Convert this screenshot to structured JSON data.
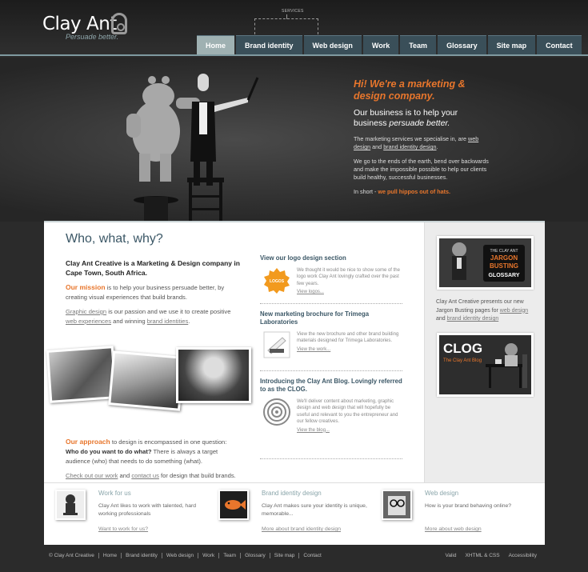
{
  "brand": {
    "name": "Clay Ant",
    "tagline": "Persuade better."
  },
  "header": {
    "services_note": "SERVICES"
  },
  "nav": [
    "Home",
    "Brand identity",
    "Web design",
    "Work",
    "Team",
    "Glossary",
    "Site map",
    "Contact"
  ],
  "hero": {
    "headline": "Hi! We're a marketing & design company.",
    "lead_a": "Our business is to help your business ",
    "lead_b": "persuade better.",
    "p1_a": "The marketing services we specialise in, are ",
    "p1_link1": "web design",
    "p1_b": " and ",
    "p1_link2": "brand identity design",
    "p1_c": ".",
    "p2": "We go to the ends of the earth, bend over backwards and make the impossible possible to help our clients build healthy, successful businesses.",
    "p3_a": "In short - ",
    "p3_b": "we pull hippos out of hats."
  },
  "main": {
    "title": "Who, what, why?",
    "intro": "Clay Ant Creative is a Marketing & Design company in Cape Town, South Africa.",
    "mission_label": "Our mission",
    "mission_text": " is to help your business persuade better, by creating visual experiences that build brands.",
    "passion_link1": "Graphic design",
    "passion_a": " is our passion and we use it to create positive ",
    "passion_link2": "web experiences",
    "passion_b": " and winning ",
    "passion_link3": "brand identities",
    "passion_c": ".",
    "approach_label": "Our approach",
    "approach_a": " to design is encompassed in one question: ",
    "approach_bold": "Who do you want to do what?",
    "approach_b": " There is always a target audience (who) that needs to do something (what).",
    "check_link1": "Check out our work",
    "check_a": " and ",
    "check_link2": "contact us",
    "check_b": " for design that build brands."
  },
  "news": [
    {
      "title": "View our logo design section",
      "text": "We thought it would be nice to show some of the logo work Clay Ant lovingly crafted over the past few years.",
      "link": "View logos...",
      "thumb_label": "LOGOS"
    },
    {
      "title": "New marketing brochure for Trimega Laboratories",
      "text": "View the new brochure and other brand building materials designed for Trimega Laboratories.",
      "link": "View the work..."
    },
    {
      "title": "Introducing the Clay Ant Blog. Lovingly referred to as the CLOG.",
      "text": "We'll deliver content about marketing, graphic design and web design that will hopefully be useful and relevant to you the entrepreneur and our fellow creatives.",
      "link": "View the blog..."
    }
  ],
  "sidebar": {
    "glossary_lines": [
      "THE CLAY ANT",
      "JARGON",
      "BUSTING",
      "GLOSSARY"
    ],
    "text_a": "Clay Ant Creative presents our new Jargon Busting pages for ",
    "link1": "web design",
    "text_b": " and ",
    "link2": "brand identity design",
    "clog_title": "CLOG",
    "clog_sub": "The Clay Ant Blog"
  },
  "bottom": [
    {
      "title": "Work for us",
      "text": "Clay Ant likes to work with talented, hard working professionals",
      "link": "Want to work for us?"
    },
    {
      "title": "Brand identity design",
      "text": "Clay Ant makes sure your identity is unique, memorable...",
      "link": "More about brand identity design"
    },
    {
      "title": "Web design",
      "text": "How is your brand behaving online?",
      "link": "More about web design"
    }
  ],
  "footer": {
    "links": [
      "© Clay Ant Creative",
      "Home",
      "Brand identity",
      "Web design",
      "Work",
      "Team",
      "Glossary",
      "Site map",
      "Contact"
    ],
    "right": [
      "Valid",
      "XHTML & CSS",
      "Accessibility"
    ]
  },
  "colors": {
    "accent": "#e8762c",
    "nav": "#3a4f59",
    "nav_active": "#9fb1b2",
    "heading": "#3b5766"
  }
}
